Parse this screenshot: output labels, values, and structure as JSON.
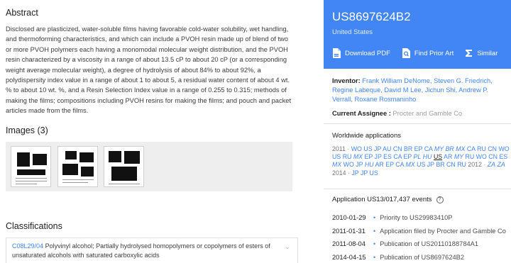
{
  "abstract": {
    "title": "Abstract",
    "text": "Disclosed are plasticized, water-soluble films having favorable cold-water solubility, wet handling, and thermoforming characteristics, and which can include a PVOH resin made up of blend of two or more PVOH polymers each having a monomodal molecular weight distribution, and the PVOH resin characterized by a viscosity in a range of about 13.5 cP to about 20 cP (or a corresponding weight average molecular weight), a degree of hydrolysis of about 84% to about 92%, a polydispersity index value in a range of about 1 to about 5, a residual water content of about 4 wt. % to about 10 wt. %, and a Resin Selection Index value in a range of 0.255 to 0.315; methods of making the films; compositions including PVOH resins for making the films; and pouch and packet articles made from the films."
  },
  "images": {
    "title": "Images (3)"
  },
  "classifications": {
    "title": "Classifications",
    "code": "C08L29/04",
    "description": "Polyvinyl alcohol; Partially hydrolysed homopolymers or copolymers of esters of unsaturated alcohols with saturated carboxylic acids"
  },
  "header": {
    "pub_number": "US8697624B2",
    "country": "United States",
    "actions": {
      "download": "Download PDF",
      "prior_art": "Find Prior Art",
      "similar": "Similar"
    }
  },
  "inventor": {
    "label": "Inventor:",
    "names": "Frank William DeNome, Steven G. Friedrich, Regine Labeque, David M Lee, Jichun Shi, Andrew P. Verrall, Roxane Rosmaninho"
  },
  "assignee": {
    "label": "Current Assignee :",
    "name": "Procter and Gamble Co"
  },
  "worldwide": {
    "title": "Worldwide applications",
    "groups": [
      {
        "year": "2011",
        "codes": [
          {
            "c": "WO"
          },
          {
            "c": "US"
          },
          {
            "c": "JP"
          },
          {
            "c": "AU"
          },
          {
            "c": "CN"
          },
          {
            "c": "BR"
          },
          {
            "c": "EP"
          },
          {
            "c": "CA"
          },
          {
            "c": "MY",
            "i": true
          },
          {
            "c": "BR",
            "i": true
          },
          {
            "c": "MX",
            "i": true
          },
          {
            "c": "CA"
          },
          {
            "c": "RU"
          },
          {
            "c": "CN"
          },
          {
            "c": "WO"
          },
          {
            "c": "US"
          },
          {
            "c": "RU"
          },
          {
            "c": "MX",
            "i": true
          },
          {
            "c": "EP"
          },
          {
            "c": "JP"
          },
          {
            "c": "ES"
          },
          {
            "c": "CA"
          },
          {
            "c": "EP"
          },
          {
            "c": "PL",
            "i": true
          },
          {
            "c": "HU",
            "i": true
          },
          {
            "c": "US",
            "cur": true
          },
          {
            "c": "AR"
          },
          {
            "c": "MY",
            "i": true
          },
          {
            "c": "RU"
          },
          {
            "c": "WO"
          },
          {
            "c": "CN"
          },
          {
            "c": "ES"
          },
          {
            "c": "MX",
            "i": true
          },
          {
            "c": "WO"
          },
          {
            "c": "JP"
          },
          {
            "c": "HU",
            "i": true
          },
          {
            "c": "AR"
          },
          {
            "c": "EP"
          },
          {
            "c": "CA"
          },
          {
            "c": "MX",
            "i": true
          },
          {
            "c": "US"
          },
          {
            "c": "JP"
          },
          {
            "c": "BR"
          },
          {
            "c": "CN"
          },
          {
            "c": "RU"
          }
        ]
      },
      {
        "year": "2012",
        "codes": [
          {
            "c": "ZA",
            "i": true
          },
          {
            "c": "ZA",
            "i": true
          }
        ]
      },
      {
        "year": "2014",
        "codes": [
          {
            "c": "JP"
          },
          {
            "c": "JP"
          },
          {
            "c": "US"
          }
        ]
      }
    ]
  },
  "events": {
    "title": "Application US13/017,437 events",
    "items": [
      {
        "date": "2010-01-29",
        "text": "Priority to US29983410P"
      },
      {
        "date": "2011-01-31",
        "text": "Application filed by Procter and Gamble Co"
      },
      {
        "date": "2011-08-04",
        "text": "Publication of US20110188784A1"
      },
      {
        "date": "2014-04-15",
        "text": "Publication of US8697624B2"
      }
    ]
  },
  "colors": {
    "accent": "#4285f4"
  },
  "icons": [
    "pdf-icon",
    "search-document-icon",
    "sigma-icon",
    "help-icon",
    "chevron-down-icon"
  ]
}
